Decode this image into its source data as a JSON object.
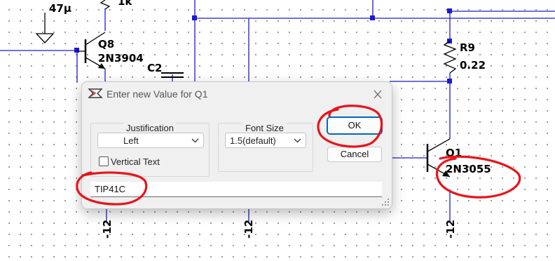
{
  "schematic": {
    "labels": {
      "cap_value": "47µ",
      "res_value_top": "1k",
      "q8_name": "Q8",
      "q8_model": "2N3904",
      "c2_name": "C2",
      "r9_name": "R9",
      "r9_value": "0.22",
      "q1_name": "Q1",
      "q1_model": "2N3055",
      "supply_left": "-12",
      "supply_mid": "-12",
      "supply_right": "-12"
    },
    "colors": {
      "wire": "#1a1ad6",
      "component": "#000000",
      "annotation": "#e8141a"
    }
  },
  "dialog": {
    "title": "Enter new Value for Q1",
    "icon": "ltspice-app-icon",
    "close_icon": "close-icon",
    "justification": {
      "label": "Justification",
      "selected": "Left"
    },
    "vertical_text": {
      "label": "Vertical Text",
      "checked": false
    },
    "font_size": {
      "label": "Font Size",
      "selected": "1.5(default)"
    },
    "ok_label": "OK",
    "cancel_label": "Cancel",
    "value_input": "TIP41C"
  }
}
